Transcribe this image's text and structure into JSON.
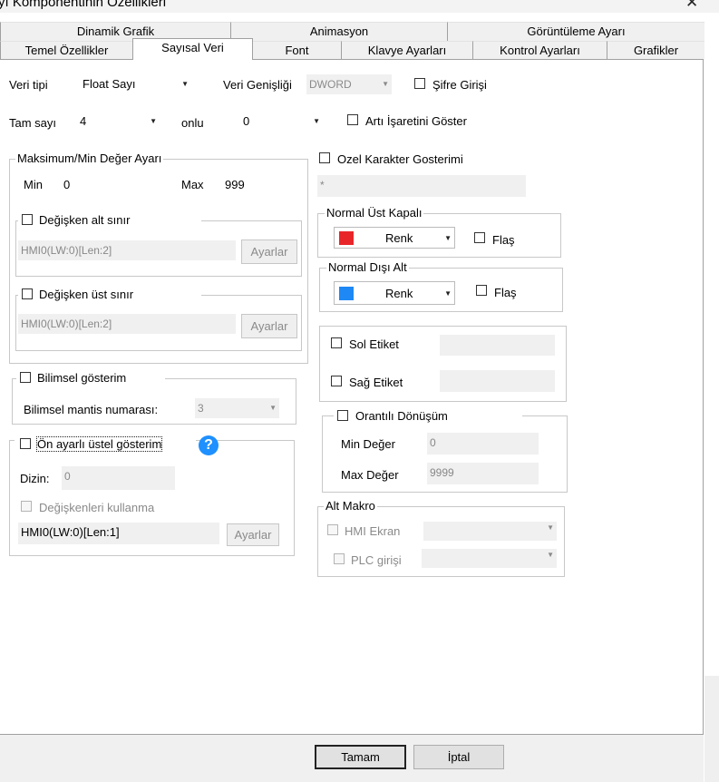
{
  "window": {
    "title": "yı Komponentinin Özellikleri",
    "close_glyph": "✕"
  },
  "tabs_top": [
    "Dinamik Grafik",
    "Animasyon",
    "Görüntüleme Ayarı"
  ],
  "tabs_bottom": [
    "Temel Özellikler",
    "Sayısal Veri",
    "Font",
    "Klavye Ayarları",
    "Kontrol Ayarları",
    "Grafikler"
  ],
  "active_tab": "Sayısal Veri",
  "form": {
    "data_type_label": "Veri tipi",
    "data_type_value": "Float Sayı",
    "data_width_label": "Veri Genişliği",
    "data_width_value": "DWORD",
    "password_label": "Şifre Girişi",
    "integer_label": "Tam sayı",
    "integer_value": "4",
    "decimal_label": "onlu",
    "decimal_value": "0",
    "plus_sign_label": "Artı İşaretini Göster"
  },
  "minmax": {
    "group_title": "Maksimum/Min Değer Ayarı",
    "min_label": "Min",
    "min_value": "0",
    "max_label": "Max",
    "max_value": "999",
    "var_lower_label": "Değişken alt sınır",
    "var_lower_addr": "HMI0(LW:0)[Len:2]",
    "var_upper_label": "Değişken üst sınır",
    "var_upper_addr": "HMI0(LW:0)[Len:2]",
    "settings_label": "Ayarlar"
  },
  "scientific": {
    "label": "Bilimsel gösterim",
    "mantissa_label": "Bilimsel mantis numarası:",
    "mantissa_value": "3"
  },
  "preset": {
    "label": "Ön ayarlı üstel gösterim",
    "help_glyph": "?",
    "index_label": "Dizin:",
    "index_value": "0",
    "use_vars_label": "Değişkenleri kullanma",
    "addr_value": "HMI0(LW:0)[Len:1]",
    "settings_label": "Ayarlar"
  },
  "special": {
    "label": "Ozel Karakter Gosterimi",
    "value": "*"
  },
  "normal_upper": {
    "title": "Normal Üst Kapalı",
    "color_label": "Renk",
    "color": "#e8262a",
    "flash_label": "Flaş"
  },
  "normal_lower": {
    "title": "Normal Dışı Alt",
    "color_label": "Renk",
    "color": "#1e88f5",
    "flash_label": "Flaş"
  },
  "labels": {
    "left_label": "Sol Etiket",
    "right_label": "Sağ Etiket"
  },
  "proportional": {
    "label": "Orantılı Dönüşüm",
    "min_label": "Min Değer",
    "min_value": "0",
    "max_label": "Max Değer",
    "max_value": "9999"
  },
  "macro": {
    "title": "Alt Makro",
    "hmi_label": "HMI Ekran",
    "plc_label": "PLC girişi"
  },
  "buttons": {
    "ok": "Tamam",
    "cancel": "İptal"
  }
}
